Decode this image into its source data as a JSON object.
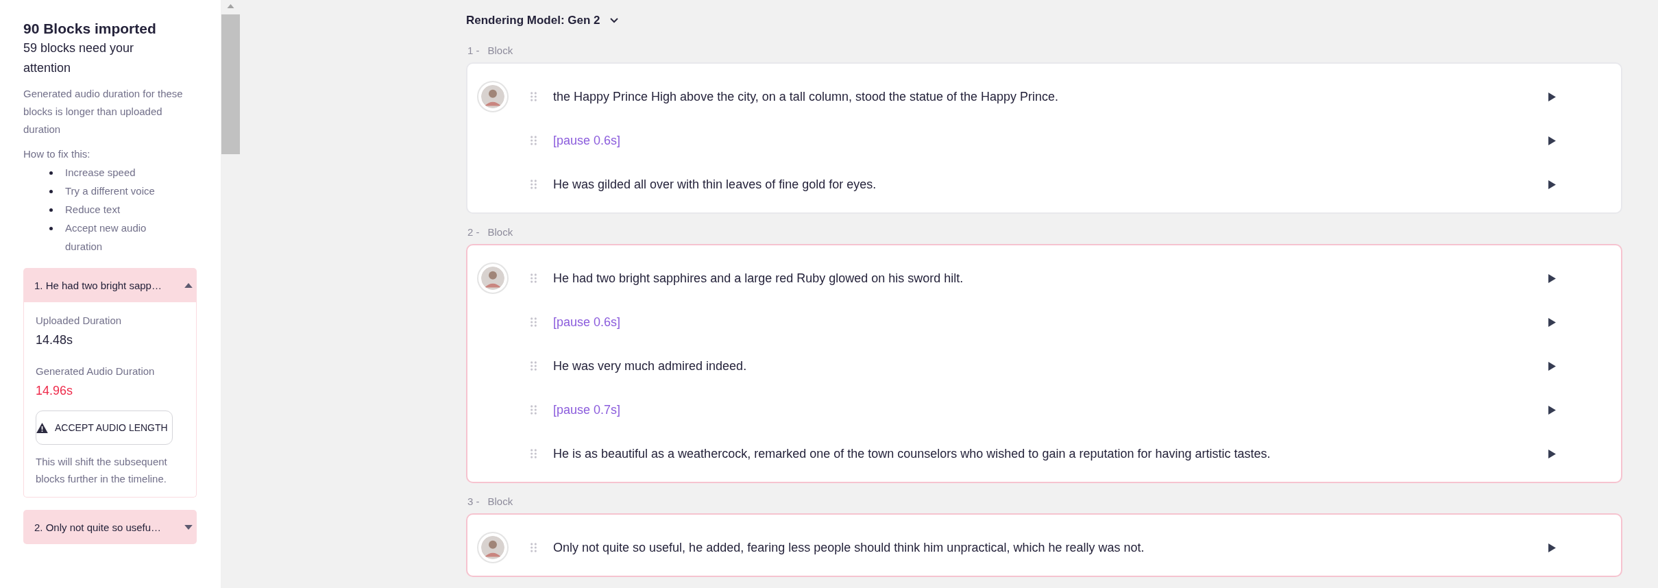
{
  "sidebar": {
    "title": "90 Blocks imported",
    "subtitle": "59 blocks need your attention",
    "description": "Generated audio duration for these blocks is longer than uploaded duration",
    "fix_heading": "How to fix this:",
    "fix_tips": [
      "Increase speed",
      "Try a different voice",
      "Reduce text",
      "Accept new audio duration"
    ],
    "issues": [
      {
        "label": "1. He had two bright sapp…",
        "expanded": true,
        "uploaded_label": "Uploaded Duration",
        "uploaded_value": "14.48s",
        "generated_label": "Generated Audio Duration",
        "generated_value": "14.96s",
        "accept_button": "ACCEPT AUDIO LENGTH",
        "note": "This will shift the subsequent blocks further in the timeline."
      },
      {
        "label": "2. Only not quite so usefu…",
        "expanded": false
      }
    ]
  },
  "rendering_model": "Rendering Model: Gen 2",
  "blocks": [
    {
      "number": "1 -",
      "label": "Block",
      "flagged": false,
      "segments": [
        {
          "kind": "text",
          "text": "the Happy Prince High above the city, on a tall column, stood the statue of the Happy Prince."
        },
        {
          "kind": "pause",
          "text": "[pause 0.6s]"
        },
        {
          "kind": "text",
          "text": "He was gilded all over with thin leaves of fine gold for eyes."
        }
      ]
    },
    {
      "number": "2 -",
      "label": "Block",
      "flagged": true,
      "segments": [
        {
          "kind": "text",
          "text": "He had two bright sapphires and a large red Ruby glowed on his sword hilt."
        },
        {
          "kind": "pause",
          "text": "[pause 0.6s]"
        },
        {
          "kind": "text",
          "text": "He was very much admired indeed."
        },
        {
          "kind": "pause",
          "text": "[pause 0.7s]"
        },
        {
          "kind": "text",
          "text": "He is as beautiful as a weathercock, remarked one of the town counselors who wished to gain a reputation for having artistic tastes."
        }
      ]
    },
    {
      "number": "3 -",
      "label": "Block",
      "flagged": true,
      "segments": [
        {
          "kind": "text",
          "text": "Only not quite so useful, he added, fearing less people should think him unpractical, which he really was not."
        }
      ]
    }
  ]
}
